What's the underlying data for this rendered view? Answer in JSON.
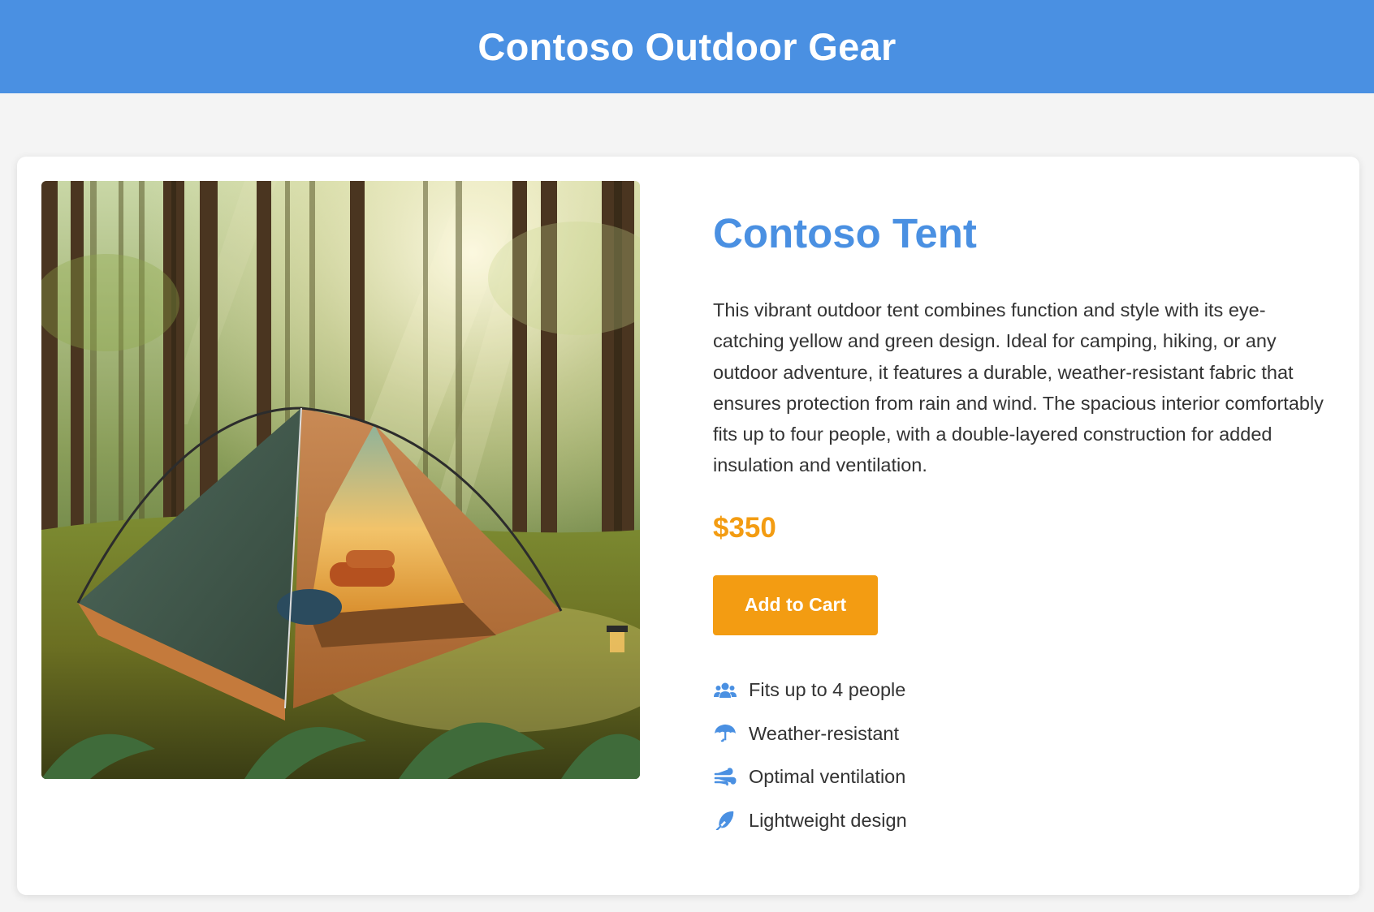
{
  "header": {
    "title": "Contoso Outdoor Gear"
  },
  "product": {
    "image": {
      "icon": "tent-in-forest-photo"
    },
    "title": "Contoso Tent",
    "description": "This vibrant outdoor tent combines function and style with its eye-catching yellow and green design. Ideal for camping, hiking, or any outdoor adventure, it features a durable, weather-resistant fabric that ensures protection from rain and wind. The spacious interior comfortably fits up to four people, with a double-layered construction for added insulation and ventilation.",
    "price": "$350",
    "add_to_cart_label": "Add to Cart",
    "features": [
      {
        "icon": "users-icon",
        "label": "Fits up to 4 people"
      },
      {
        "icon": "umbrella-icon",
        "label": "Weather-resistant"
      },
      {
        "icon": "wind-icon",
        "label": "Optimal ventilation"
      },
      {
        "icon": "feather-icon",
        "label": "Lightweight design"
      }
    ]
  },
  "colors": {
    "header_bg": "#4a90e2",
    "accent_blue": "#4a90e2",
    "price_orange": "#f39c12",
    "button_orange": "#f39c12",
    "page_bg": "#f4f4f4"
  }
}
